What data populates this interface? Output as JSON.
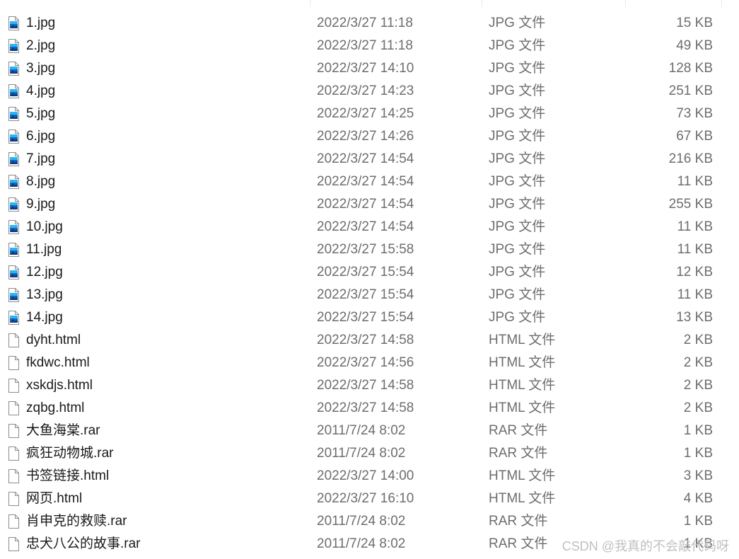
{
  "files": [
    {
      "name": "1.jpg",
      "date": "2022/3/27 11:18",
      "type": "JPG 文件",
      "size": "15 KB",
      "icon": "image-file-icon"
    },
    {
      "name": "2.jpg",
      "date": "2022/3/27 11:18",
      "type": "JPG 文件",
      "size": "49 KB",
      "icon": "image-file-icon"
    },
    {
      "name": "3.jpg",
      "date": "2022/3/27 14:10",
      "type": "JPG 文件",
      "size": "128 KB",
      "icon": "image-file-icon"
    },
    {
      "name": "4.jpg",
      "date": "2022/3/27 14:23",
      "type": "JPG 文件",
      "size": "251 KB",
      "icon": "image-file-icon"
    },
    {
      "name": "5.jpg",
      "date": "2022/3/27 14:25",
      "type": "JPG 文件",
      "size": "73 KB",
      "icon": "image-file-icon"
    },
    {
      "name": "6.jpg",
      "date": "2022/3/27 14:26",
      "type": "JPG 文件",
      "size": "67 KB",
      "icon": "image-file-icon"
    },
    {
      "name": "7.jpg",
      "date": "2022/3/27 14:54",
      "type": "JPG 文件",
      "size": "216 KB",
      "icon": "image-file-icon"
    },
    {
      "name": "8.jpg",
      "date": "2022/3/27 14:54",
      "type": "JPG 文件",
      "size": "11 KB",
      "icon": "image-file-icon"
    },
    {
      "name": "9.jpg",
      "date": "2022/3/27 14:54",
      "type": "JPG 文件",
      "size": "255 KB",
      "icon": "image-file-icon"
    },
    {
      "name": "10.jpg",
      "date": "2022/3/27 14:54",
      "type": "JPG 文件",
      "size": "11 KB",
      "icon": "image-file-icon"
    },
    {
      "name": "11.jpg",
      "date": "2022/3/27 15:58",
      "type": "JPG 文件",
      "size": "11 KB",
      "icon": "image-file-icon"
    },
    {
      "name": "12.jpg",
      "date": "2022/3/27 15:54",
      "type": "JPG 文件",
      "size": "12 KB",
      "icon": "image-file-icon"
    },
    {
      "name": "13.jpg",
      "date": "2022/3/27 15:54",
      "type": "JPG 文件",
      "size": "11 KB",
      "icon": "image-file-icon"
    },
    {
      "name": "14.jpg",
      "date": "2022/3/27 15:54",
      "type": "JPG 文件",
      "size": "13 KB",
      "icon": "image-file-icon"
    },
    {
      "name": "dyht.html",
      "date": "2022/3/27 14:58",
      "type": "HTML 文件",
      "size": "2 KB",
      "icon": "blank-file-icon"
    },
    {
      "name": "fkdwc.html",
      "date": "2022/3/27 14:56",
      "type": "HTML 文件",
      "size": "2 KB",
      "icon": "blank-file-icon"
    },
    {
      "name": "xskdjs.html",
      "date": "2022/3/27 14:58",
      "type": "HTML 文件",
      "size": "2 KB",
      "icon": "blank-file-icon"
    },
    {
      "name": "zqbg.html",
      "date": "2022/3/27 14:58",
      "type": "HTML 文件",
      "size": "2 KB",
      "icon": "blank-file-icon"
    },
    {
      "name": "大鱼海棠.rar",
      "date": "2011/7/24 8:02",
      "type": "RAR 文件",
      "size": "1 KB",
      "icon": "blank-file-icon"
    },
    {
      "name": "疯狂动物城.rar",
      "date": "2011/7/24 8:02",
      "type": "RAR 文件",
      "size": "1 KB",
      "icon": "blank-file-icon"
    },
    {
      "name": "书签链接.html",
      "date": "2022/3/27 14:00",
      "type": "HTML 文件",
      "size": "3 KB",
      "icon": "blank-file-icon"
    },
    {
      "name": "网页.html",
      "date": "2022/3/27 16:10",
      "type": "HTML 文件",
      "size": "4 KB",
      "icon": "blank-file-icon"
    },
    {
      "name": "肖申克的救赎.rar",
      "date": "2011/7/24 8:02",
      "type": "RAR 文件",
      "size": "1 KB",
      "icon": "blank-file-icon"
    },
    {
      "name": "忠犬八公的故事.rar",
      "date": "2011/7/24 8:02",
      "type": "RAR 文件",
      "size": "1 KB",
      "icon": "blank-file-icon"
    }
  ],
  "watermark": "CSDN @我真的不会敲代码呀",
  "colors": {
    "name_text": "#1a1a1a",
    "detail_text": "#6d6d6d",
    "image_icon_blue": "#1565c0",
    "image_icon_sky": "#29b6f6",
    "file_icon_border": "#8c8c8c",
    "watermark": "#c0c0c0"
  }
}
